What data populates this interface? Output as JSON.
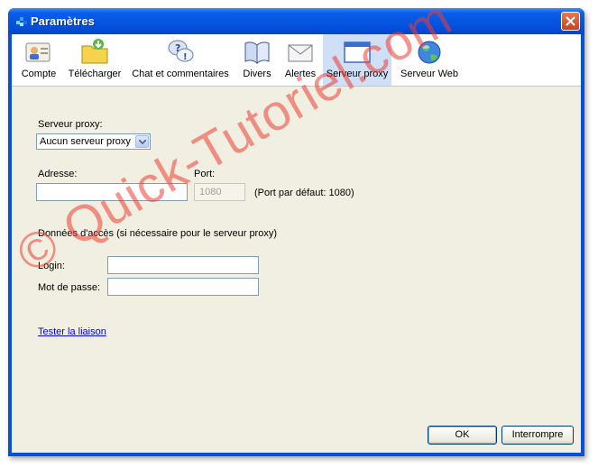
{
  "window": {
    "title": "Paramètres"
  },
  "toolbar": {
    "items": [
      {
        "label": "Compte",
        "icon": "user-card-icon"
      },
      {
        "label": "Télécharger",
        "icon": "download-folder-icon"
      },
      {
        "label": "Chat et commentaires",
        "icon": "chat-question-icon"
      },
      {
        "label": "Divers",
        "icon": "book-icon"
      },
      {
        "label": "Alertes",
        "icon": "envelope-icon"
      },
      {
        "label": "Serveur proxy",
        "icon": "window-icon"
      },
      {
        "label": "Serveur Web",
        "icon": "globe-icon"
      }
    ],
    "active": "Serveur proxy"
  },
  "proxy": {
    "server_label": "Serveur proxy:",
    "server_value": "Aucun serveur proxy",
    "address_label": "Adresse:",
    "address_value": "",
    "port_label": "Port:",
    "port_value": "1080",
    "port_hint": "(Port par défaut: 1080)",
    "access_heading": "Données d'accès (si nécessaire pour le serveur proxy)",
    "login_label": "Login:",
    "login_value": "",
    "password_label": "Mot de passe:",
    "password_value": "",
    "test_link": "Tester la liaison"
  },
  "buttons": {
    "ok": "OK",
    "cancel": "Interrompre"
  },
  "watermark": "© Quick-Tutoriel.com",
  "colors": {
    "titlebar": "#0553e0",
    "active_tab": "#cfe0f6",
    "watermark": "#ee3c32"
  }
}
